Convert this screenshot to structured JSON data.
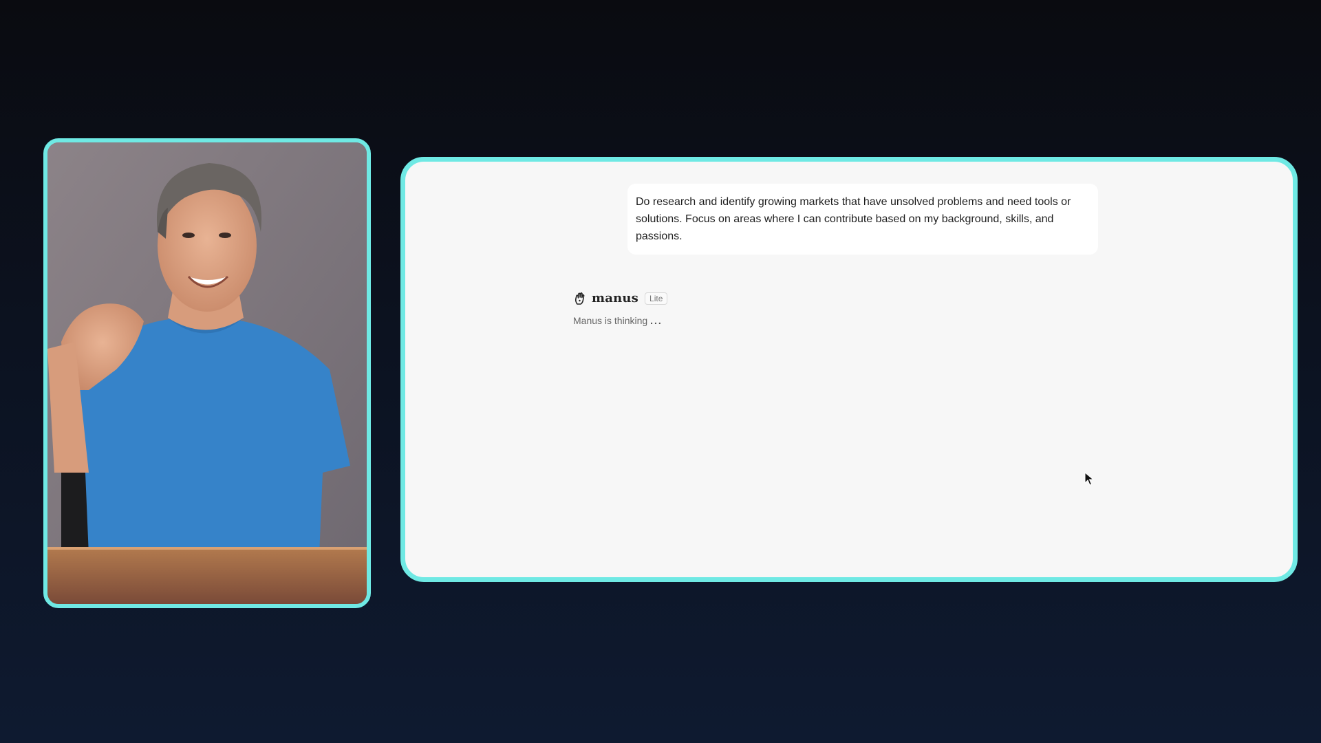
{
  "chat": {
    "user_message": "Do research and identify growing markets that have unsolved problems and need tools or solutions. Focus on areas where I can contribute based on my background, skills, and passions.",
    "agent": {
      "name": "manus",
      "badge": "Lite",
      "status": "Manus is thinking",
      "status_dots": "..."
    }
  },
  "colors": {
    "frame_accent": "#6fe9e4",
    "panel_background": "#f7f7f7",
    "page_background": "#0c1220"
  },
  "icons": {
    "agent_logo": "manus-hand-icon",
    "cursor": "mouse-pointer-icon"
  }
}
